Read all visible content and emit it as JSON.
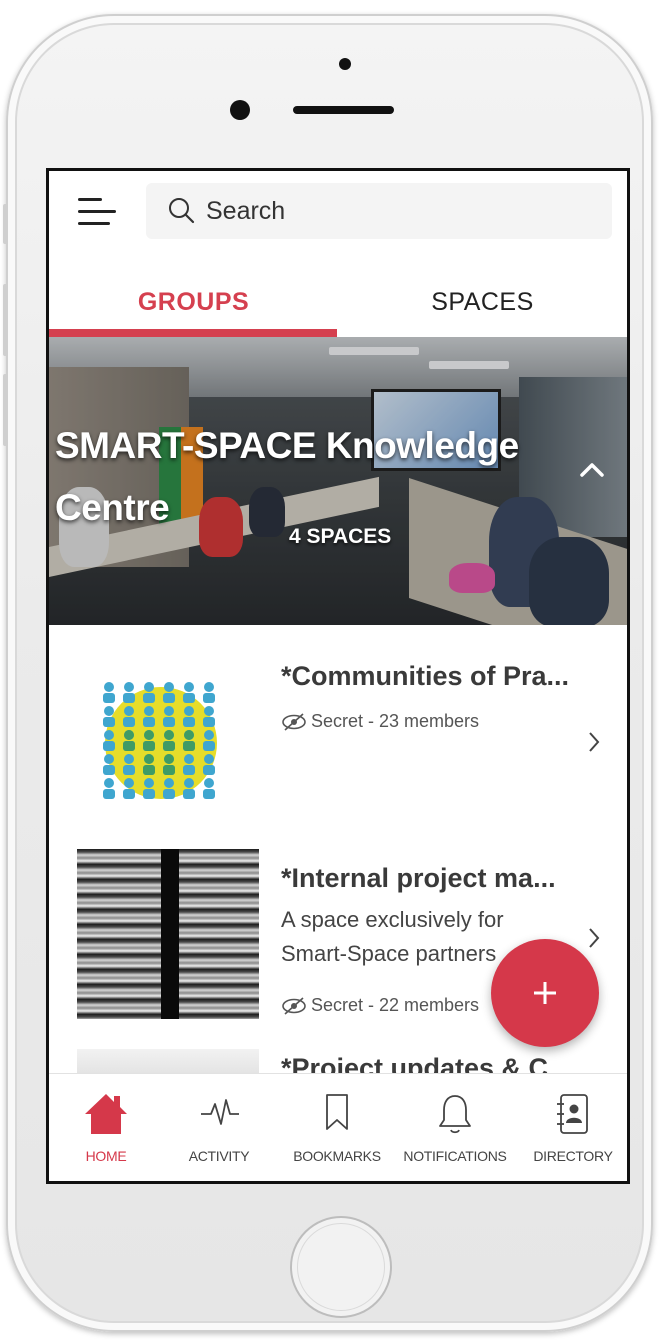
{
  "search": {
    "placeholder": "Search"
  },
  "tabs": [
    {
      "label": "GROUPS",
      "active": true
    },
    {
      "label": "SPACES",
      "active": false
    }
  ],
  "hero": {
    "title": "SMART-SPACE Knowledge Centre",
    "count": "4 SPACES"
  },
  "items": [
    {
      "title": "*Communities of Pra...",
      "meta": "Secret - 23 members",
      "description": ""
    },
    {
      "title": "*Internal project ma...",
      "description": "A space exclusively for Smart-Space partners",
      "meta": "Secret - 22 members"
    },
    {
      "title": "*Project updates & C...",
      "description": "",
      "meta": ""
    }
  ],
  "bottom_nav": [
    {
      "label": "HOME",
      "icon": "home-icon",
      "active": true
    },
    {
      "label": "ACTIVITY",
      "icon": "activity-icon",
      "active": false
    },
    {
      "label": "BOOKMARKS",
      "icon": "bookmark-icon",
      "active": false
    },
    {
      "label": "NOTIFICATIONS",
      "icon": "bell-icon",
      "active": false
    },
    {
      "label": "DIRECTORY",
      "icon": "directory-icon",
      "active": false
    }
  ],
  "colors": {
    "accent": "#d5384a",
    "tab_active": "#d5404f"
  }
}
